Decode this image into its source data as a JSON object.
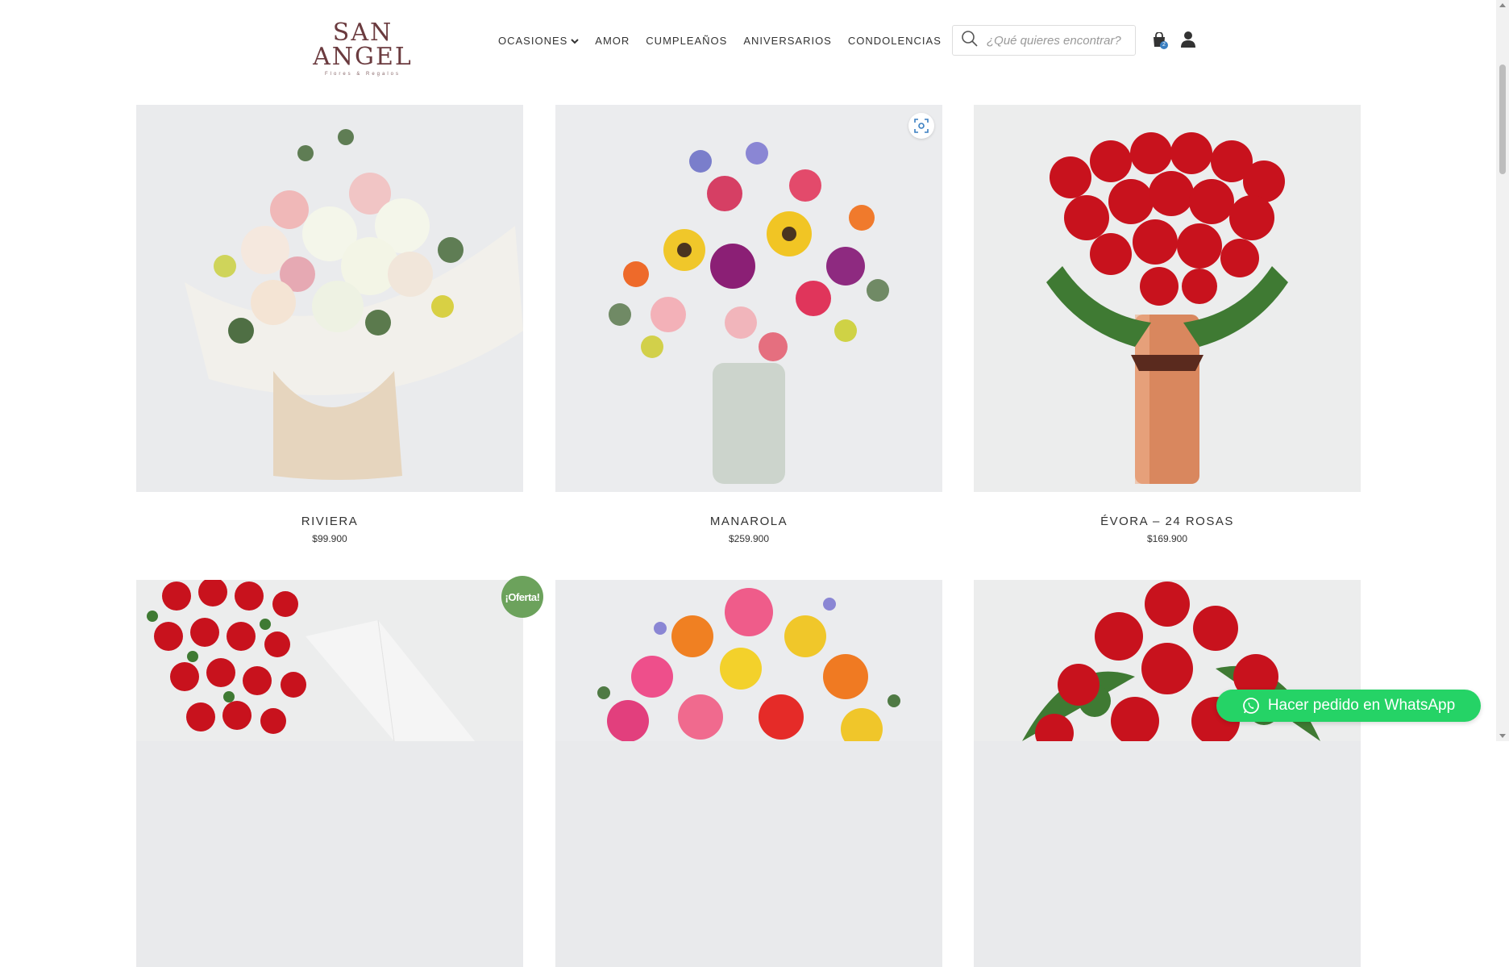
{
  "header": {
    "logo_text": "SAN ANGEL",
    "logo_tagline": "Flores & Regalos",
    "nav": [
      {
        "label": "OCASIONES",
        "has_dropdown": true
      },
      {
        "label": "AMOR"
      },
      {
        "label": "CUMPLEAÑOS"
      },
      {
        "label": "ANIVERSARIOS"
      },
      {
        "label": "CONDOLENCIAS"
      }
    ],
    "search_placeholder": "¿Qué quieres encontrar?",
    "cart_count": "2"
  },
  "products": [
    {
      "name": "RIVIERA",
      "price": "$99.900"
    },
    {
      "name": "MANAROLA",
      "price": "$259.900"
    },
    {
      "name": "ÉVORA – 24 ROSAS",
      "price": "$169.900"
    }
  ],
  "badges": {
    "sale": "¡Oferta!"
  },
  "whatsapp": {
    "label": "Hacer pedido en WhatsApp"
  },
  "colors": {
    "brand": "#6b3b3f",
    "whatsapp": "#25d366",
    "sale": "#6ca25c"
  }
}
